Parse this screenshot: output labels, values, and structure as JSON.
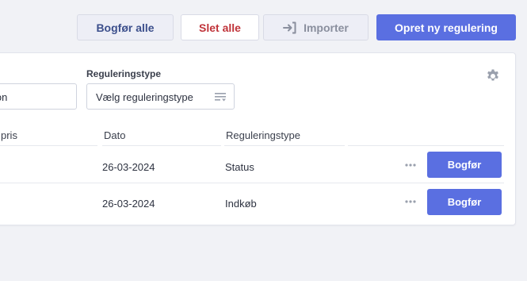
{
  "toolbar": {
    "post_all_label": "Bogfør alle",
    "delete_all_label": "Slet alle",
    "import_label": "Importer",
    "create_label": "Opret ny regulering"
  },
  "filters": {
    "search_value_partial": "ion",
    "type_label": "Reguleringstype",
    "type_placeholder": "Vælg reguleringstype"
  },
  "table": {
    "columns": [
      "pris",
      "Dato",
      "Reguleringstype"
    ],
    "rows": [
      {
        "date": "26-03-2024",
        "type": "Status",
        "action_label": "Bogfør"
      },
      {
        "date": "26-03-2024",
        "type": "Indkøb",
        "action_label": "Bogfør"
      }
    ]
  },
  "colors": {
    "primary": "#5a6fe1",
    "danger": "#c0343a",
    "background": "#f1f2f6"
  }
}
